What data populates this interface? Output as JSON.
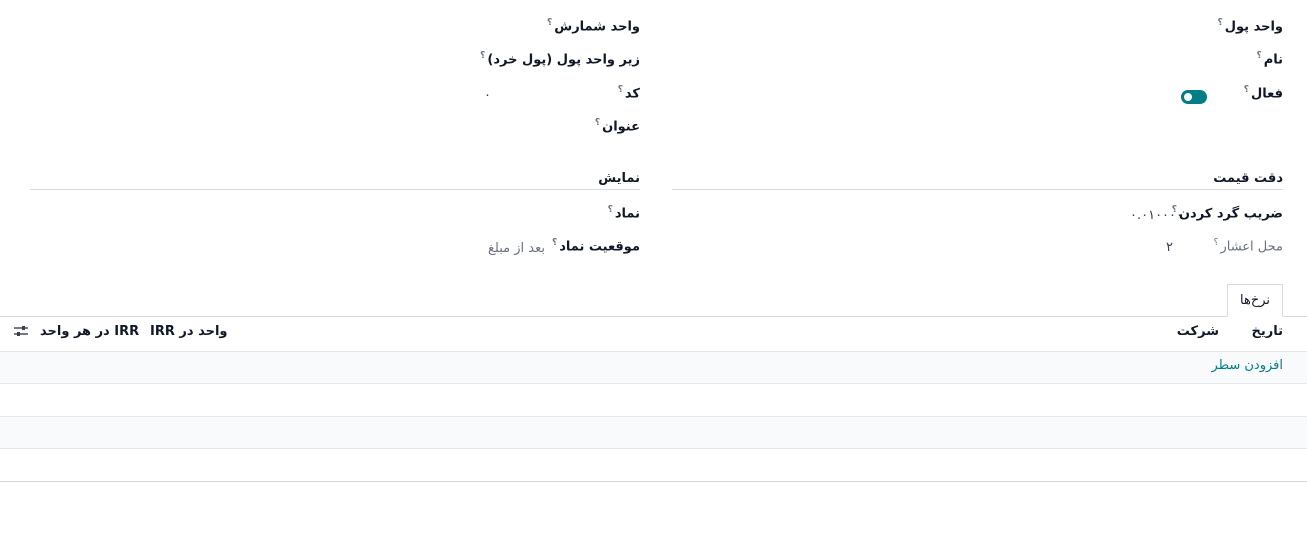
{
  "fields": {
    "currency": {
      "label": "واحد پول"
    },
    "name": {
      "label": "نام"
    },
    "active": {
      "label": "فعال",
      "value": true
    },
    "unit": {
      "label": "واحد شمارش"
    },
    "subunit": {
      "label": "زیر واحد پول (پول خرد)"
    },
    "code": {
      "label": "کد",
      "value": "۰"
    },
    "title": {
      "label": "عنوان"
    }
  },
  "sections": {
    "price_precision": "دقت قیمت",
    "display": "نمایش"
  },
  "precision": {
    "rounding": {
      "label": "ضریب گرد کردن",
      "value": "۰.۰۱۰۰۰۰"
    },
    "decimal_places": {
      "label": "محل اعشار",
      "value": "۲"
    }
  },
  "display": {
    "symbol": {
      "label": "نماد"
    },
    "symbol_position": {
      "label": "موقعیت نماد",
      "value": "بعد از مبلغ"
    }
  },
  "tabs": [
    "نرخ‌ها"
  ],
  "rates_table": {
    "columns": [
      "تاریخ",
      "شرکت",
      "واحد در IRR",
      "IRR در هر واحد"
    ],
    "add_line": "افزودن سطر"
  },
  "icons": {
    "help": "question-mark",
    "settings": "sliders-icon"
  },
  "colors": {
    "accent": "#017e84"
  }
}
